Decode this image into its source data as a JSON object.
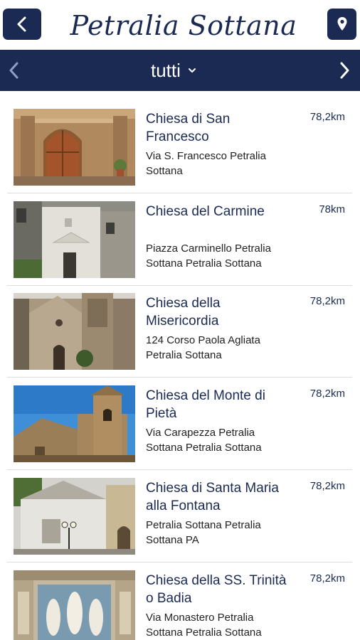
{
  "header": {
    "title": "Petralia Sottana",
    "back_icon": "chevron-left-icon",
    "location_icon": "map-pin-icon"
  },
  "filter": {
    "selected": "tutti",
    "prev_icon": "chevron-left-icon",
    "next_icon": "chevron-right-icon",
    "dropdown_icon": "chevron-down-icon"
  },
  "colors": {
    "primary": "#1a2a52",
    "separator": "#dddddd"
  },
  "items": [
    {
      "name": "Chiesa di San Francesco",
      "address": "Via S. Francesco Petralia Sottana",
      "distance": "78,2km",
      "image": "stone-church-facade-with-wooden-door"
    },
    {
      "name": "Chiesa del Carmine",
      "address": "Piazza Carminello Petralia Sottana Petralia Sottana",
      "distance": "78km",
      "image": "white-church-facade"
    },
    {
      "name": "Chiesa della Misericordia",
      "address": "124 Corso Paola Agliata Petralia Sottana",
      "distance": "78,2km",
      "image": "stone-church-with-arched-door"
    },
    {
      "name": "Chiesa del Monte di Pietà",
      "address": "Via Carapezza Petralia Sottana Petralia Sottana",
      "distance": "78,2km",
      "image": "stone-bell-tower-blue-sky"
    },
    {
      "name": "Chiesa di Santa Maria alla Fontana",
      "address": "Petralia Sottana Petralia Sottana PA",
      "distance": "78,2km",
      "image": "white-church-with-street-lamp"
    },
    {
      "name": "Chiesa della SS. Trinità o Badia",
      "address": "Via Monastero Petralia Sottana Petralia Sottana",
      "distance": "78,2km",
      "image": "marble-altarpiece-statues"
    }
  ]
}
